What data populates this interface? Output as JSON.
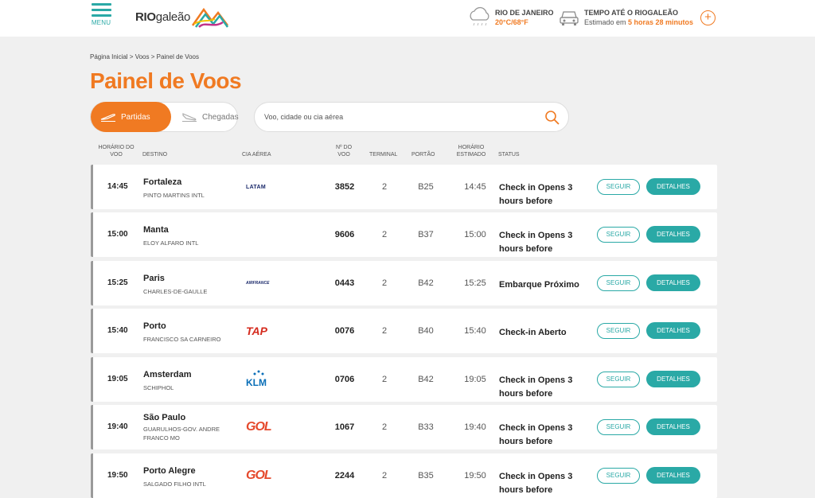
{
  "header": {
    "menu_label": "MENU",
    "logo_prefix": "RIO",
    "logo_suffix": "galeão",
    "weather_city": "RIO DE JANEIRO",
    "weather_temp": "20°C/68°F",
    "eta_title": "TEMPO ATÉ O RIOGALEÃO",
    "eta_prefix": "Estimado em ",
    "eta_value": "5 horas 28 minutos",
    "plus": "+"
  },
  "breadcrumb": "Página Inicial > Voos > Painel de Voos",
  "page_title": "Painel de Voos",
  "toggle": {
    "departures": "Partidas",
    "arrivals": "Chegadas"
  },
  "search": {
    "placeholder": "Voo, cidade ou cia aérea"
  },
  "columns": {
    "time": "HORÁRIO DO VOO",
    "destination": "DESTINO",
    "airline": "CIA AÉREA",
    "flight_no": "Nº DO VOO",
    "terminal": "TERMINAL",
    "gate": "PORTÃO",
    "estimated": "HORÁRIO ESTIMADO",
    "status": "STATUS"
  },
  "buttons": {
    "follow": "SEGUIR",
    "details": "DETALHES"
  },
  "flights": [
    {
      "time": "14:45",
      "city": "Fortaleza",
      "airport": "PINTO MARTINS INTL",
      "airline": "LATAM",
      "number": "3852",
      "terminal": "2",
      "gate": "B25",
      "estimated": "14:45",
      "status": "Check in Opens 3 hours before"
    },
    {
      "time": "15:00",
      "city": "Manta",
      "airport": "ELOY ALFARO INTL",
      "airline": "",
      "number": "9606",
      "terminal": "2",
      "gate": "B37",
      "estimated": "15:00",
      "status": "Check in Opens 3 hours before"
    },
    {
      "time": "15:25",
      "city": "Paris",
      "airport": "CHARLES-DE-GAULLE",
      "airline": "AIRFRANCE",
      "number": "0443",
      "terminal": "2",
      "gate": "B42",
      "estimated": "15:25",
      "status": "Embarque Próximo"
    },
    {
      "time": "15:40",
      "city": "Porto",
      "airport": "FRANCISCO SA CARNEIRO",
      "airline": "TAP",
      "number": "0076",
      "terminal": "2",
      "gate": "B40",
      "estimated": "15:40",
      "status": "Check-in Aberto"
    },
    {
      "time": "19:05",
      "city": "Amsterdam",
      "airport": "SCHIPHOL",
      "airline": "KLM",
      "number": "0706",
      "terminal": "2",
      "gate": "B42",
      "estimated": "19:05",
      "status": "Check in Opens 3 hours before"
    },
    {
      "time": "19:40",
      "city": "São Paulo",
      "airport": "GUARULHOS-GOV. ANDRE FRANCO MO",
      "airline": "GOL",
      "number": "1067",
      "terminal": "2",
      "gate": "B33",
      "estimated": "19:40",
      "status": "Check in Opens 3 hours before"
    },
    {
      "time": "19:50",
      "city": "Porto Alegre",
      "airport": "SALGADO FILHO INTL",
      "airline": "GOL",
      "number": "2244",
      "terminal": "2",
      "gate": "B35",
      "estimated": "19:50",
      "status": "Check in Opens 3 hours before"
    }
  ],
  "colors": {
    "accent": "#f07a22",
    "teal": "#2aa9a6"
  }
}
